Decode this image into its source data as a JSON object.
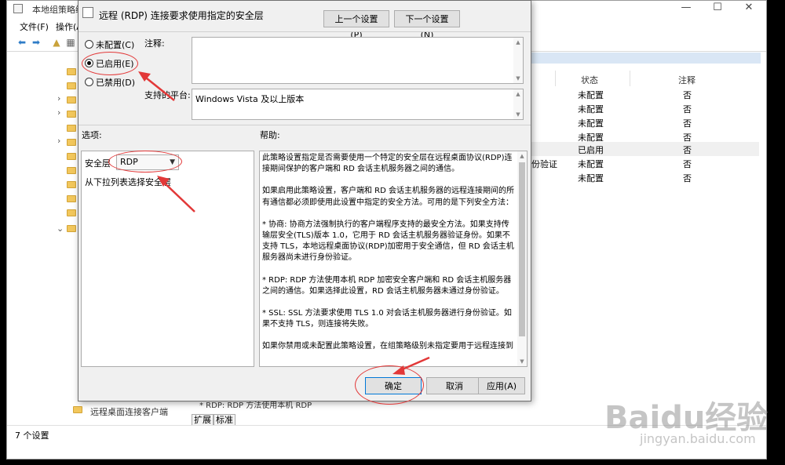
{
  "background_window": {
    "title": "本地组策略编",
    "controls": {
      "minimize": "—",
      "maximize": "☐",
      "close": "✕"
    },
    "menu": [
      "文件(F)",
      "操作(A"
    ],
    "columns": {
      "state": "状态",
      "comment": "注释"
    },
    "rows": [
      {
        "name": "",
        "state": "未配置",
        "comment": "否"
      },
      {
        "name": "",
        "state": "未配置",
        "comment": "否"
      },
      {
        "name": "",
        "state": "未配置",
        "comment": "否"
      },
      {
        "name": "",
        "state": "未配置",
        "comment": "否"
      },
      {
        "name": "",
        "state": "已启用",
        "comment": "否"
      },
      {
        "name": "份验证",
        "state": "未配置",
        "comment": "否"
      },
      {
        "name": "",
        "state": "未配置",
        "comment": "否"
      }
    ],
    "tree_bottom_item": "远程桌面连接客户端",
    "description_peek": "* RDP: RDP 方法使用本机 RDP",
    "tabs": [
      "扩展",
      "标准"
    ],
    "status_text": "7 个设置"
  },
  "dialog": {
    "title": "远程 (RDP) 连接要求使用指定的安全层",
    "prev_button": "上一个设置(P)",
    "next_button": "下一个设置(N)",
    "radios": [
      {
        "label": "未配置(C)",
        "selected": false
      },
      {
        "label": "已启用(E)",
        "selected": true
      },
      {
        "label": "已禁用(D)",
        "selected": false
      }
    ],
    "comment_label": "注释:",
    "comment_value": "",
    "platform_label": "支持的平台:",
    "platform_value": "Windows Vista 及以上版本",
    "options_label": "选项:",
    "help_label": "帮助:",
    "security_layer_label": "安全层",
    "security_layer_value": "RDP",
    "security_layer_hint": "从下拉列表选择安全层",
    "help_paragraphs": [
      "此策略设置指定是否需要使用一个特定的安全层在远程桌面协议(RDP)连接期间保护的客户端和 RD 会话主机服务器之间的通信。",
      "如果启用此策略设置，客户端和 RD 会话主机服务器的远程连接期间的所有通信都必须即使用此设置中指定的安全方法。可用的是下列安全方法：",
      "* 协商: 协商方法强制执行的客户端程序支持的最安全方法。如果支持传输层安全(TLS)版本 1.0，它用于 RD 会话主机服务器验证身份。如果不支持 TLS，本地远程桌面协议(RDP)加密用于安全通信，但 RD 会话主机服务器尚未进行身份验证。",
      "* RDP: RDP 方法使用本机 RDP 加密安全客户端和 RD 会话主机服务器之间的通信。如果选择此设置，RD 会话主机服务器未通过身份验证。",
      "* SSL: SSL 方法要求使用 TLS 1.0 对会话主机服务器进行身份验证。如果不支持 TLS，则连接将失败。",
      "如果你禁用或未配置此策略设置，在组策略级别未指定要用于远程连接到"
    ],
    "ok_button": "确定",
    "cancel_button": "取消",
    "apply_button": "应用(A)"
  },
  "watermark": {
    "logo": "Baidu经验",
    "url": "jingyan.baidu.com"
  },
  "colors": {
    "annotation": "#e23838",
    "selection": "#d9e6f5",
    "folder": "#f2c75c"
  }
}
